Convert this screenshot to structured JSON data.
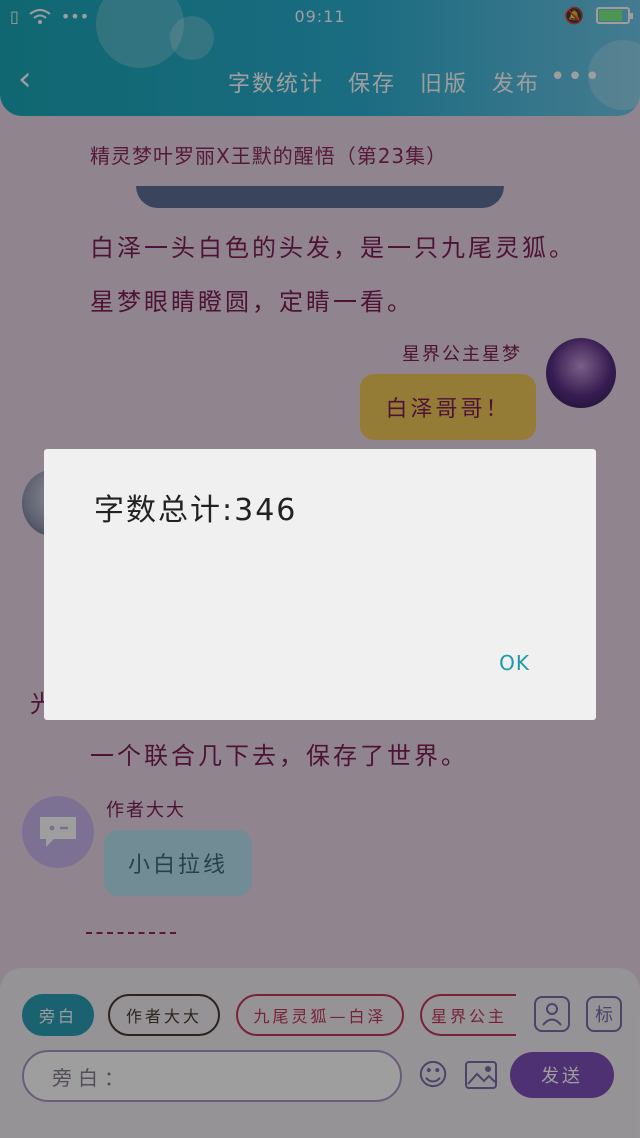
{
  "status_bar": {
    "time": "09:11"
  },
  "header": {
    "actions": [
      "字数统计",
      "保存",
      "旧版",
      "发布"
    ]
  },
  "content": {
    "story_title": "精灵梦叶罗丽X王默的醒悟（第23集）",
    "narration_1": "白泽一头白色的头发，是一只九尾灵狐。",
    "narration_2": "星梦眼睛瞪圆，定睛一看。",
    "sender_1": "星界公主星梦",
    "message_1": "白泽哥哥！",
    "partial_text": "光",
    "narration_3": "一个联合几下去，保存了世界。",
    "sender_2": "作者大大",
    "message_2": "小白拉线",
    "colors": {
      "bubble_right": "#f0c858",
      "bubble_left": "#b9e2f3"
    }
  },
  "bottom": {
    "chips": [
      "旁白",
      "作者大大",
      "九尾灵狐—白泽",
      "星界公主"
    ],
    "character_icon": "person-icon",
    "tag_label": "标",
    "input_placeholder": "旁白：",
    "send_label": "发送"
  },
  "dialog": {
    "message": "字数总计:346",
    "ok_label": "OK"
  }
}
